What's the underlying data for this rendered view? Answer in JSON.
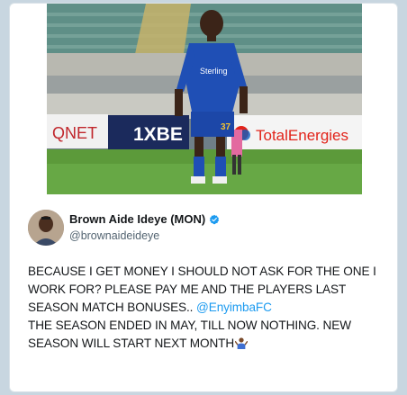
{
  "tweet": {
    "author_name": "Brown Aide Ideye (MON)",
    "author_handle": "@brownaideideye",
    "text_part1": "BECAUSE I GET MONEY I SHOULD NOT ASK FOR THE ONE I WORK FOR? PLEASE PAY ME AND THE PLAYERS LAST SEASON MATCH BONUSES.. ",
    "mention": "@EnyimbaFC",
    "text_part2": "THE SEASON ENDED IN MAY, TILL NOW NOTHING. NEW SEASON WILL START NEXT MONTH",
    "emoji_name": "person-shrugging-icon"
  },
  "photo": {
    "boards": [
      "QNET",
      "1XBE",
      "TotalEnergies"
    ],
    "jersey_sponsor": "Sterling",
    "jersey_number": "37"
  },
  "colors": {
    "mention": "#1d9bf0",
    "verified": "#1d9bf0",
    "jersey": "#1f4fb5"
  }
}
